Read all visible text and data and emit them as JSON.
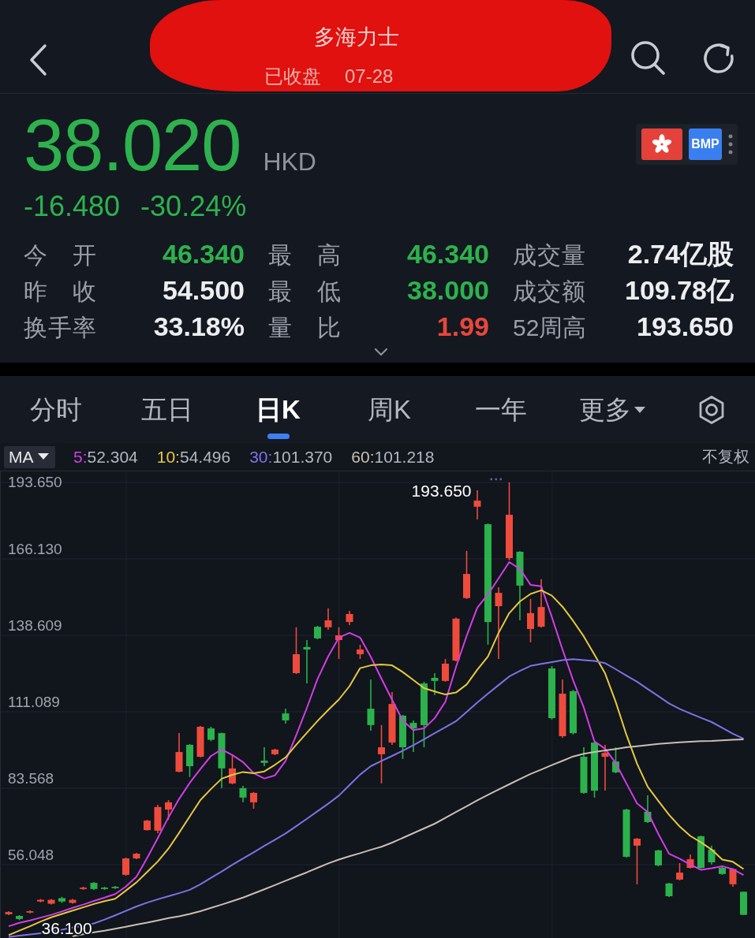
{
  "header": {
    "redacted": true,
    "title": "多海力士",
    "status": "已收盘",
    "date": "07-28"
  },
  "quote": {
    "price": "38.020",
    "currency": "HKD",
    "falling": true,
    "change": "-16.480",
    "change_percent": "-30.24%",
    "badge": "BMP"
  },
  "stats": [
    {
      "label": "今 开",
      "value": "46.340",
      "color": "#2db24e"
    },
    {
      "label": "最 高",
      "value": "46.340",
      "color": "#2db24e"
    },
    {
      "label": "成交量",
      "value": "2.74亿股",
      "color": "#eceef1"
    },
    {
      "label": "昨 收",
      "value": "54.500",
      "color": "#eceef1"
    },
    {
      "label": "最 低",
      "value": "38.000",
      "color": "#2db24e"
    },
    {
      "label": "成交额",
      "value": "109.78亿",
      "color": "#eceef1"
    },
    {
      "label": "换手率",
      "value": "33.18%",
      "color": "#eceef1"
    },
    {
      "label": "量 比",
      "value": "1.99",
      "color": "#e9463b"
    },
    {
      "label": "52周高",
      "value": "193.650",
      "color": "#eceef1"
    }
  ],
  "tabs": [
    {
      "label": "分时",
      "kind": "tab",
      "selected": false
    },
    {
      "label": "五日",
      "kind": "tab",
      "selected": false
    },
    {
      "label": "日K",
      "kind": "tab",
      "selected": true
    },
    {
      "label": "周K",
      "kind": "tab",
      "selected": false
    },
    {
      "label": "一年",
      "kind": "tab",
      "selected": false
    },
    {
      "label": "更多",
      "kind": "menu",
      "selected": false
    }
  ],
  "chart": {
    "indicator": "MA",
    "ma_legend": [
      {
        "label": "5:",
        "value": "52.304",
        "color": "#d23ee6"
      },
      {
        "label": "10:",
        "value": "54.496",
        "color": "#e6c940"
      },
      {
        "label": "30:",
        "value": "101.370",
        "color": "#7b74e6"
      },
      {
        "label": "60:",
        "value": "101.218",
        "color": "#c8c0b4"
      }
    ],
    "adjustment": "不复权",
    "chart_data": {
      "type": "candlestick",
      "grid": true,
      "ylim": [
        29.66,
        197.91
      ],
      "yticks": [
        {
          "value": 193.65,
          "label": "193.650"
        },
        {
          "value": 166.13,
          "label": "166.130"
        },
        {
          "value": 138.609,
          "label": "138.609"
        },
        {
          "value": 111.089,
          "label": "111.089"
        },
        {
          "value": 83.568,
          "label": "83.568"
        },
        {
          "value": 56.048,
          "label": "56.048"
        }
      ],
      "categories": [
        null,
        null,
        null,
        null,
        null,
        null,
        null,
        null,
        null,
        null,
        null,
        null,
        null,
        null,
        null,
        null,
        null,
        null,
        null,
        null,
        null,
        null,
        null,
        null,
        null,
        null,
        null,
        null,
        null,
        null,
        null,
        null,
        null,
        null,
        null,
        null,
        null,
        null,
        null,
        null,
        null,
        null,
        null,
        null,
        null,
        null,
        null,
        null,
        null,
        null,
        null,
        null,
        null,
        null,
        null,
        null,
        null,
        null,
        null,
        null,
        null,
        null,
        null,
        null,
        null,
        null,
        null,
        null,
        null,
        null
      ],
      "ohlc": [
        [
          38.2,
          39.3,
          37.9,
          39.0
        ],
        [
          37.6,
          37.9,
          36.1,
          36.5
        ],
        [
          38.8,
          39.6,
          38.5,
          39.3
        ],
        [
          42.8,
          43.7,
          42.5,
          43.4
        ],
        [
          42.0,
          43.7,
          41.7,
          43.4
        ],
        [
          44.0,
          44.5,
          42.3,
          42.8
        ],
        [
          42.3,
          43.7,
          42.0,
          43.4
        ],
        [
          47.3,
          48.1,
          47.0,
          47.8
        ],
        [
          49.5,
          49.8,
          47.0,
          47.3
        ],
        [
          47.8,
          48.1,
          47.0,
          47.3
        ],
        [
          48.1,
          48.4,
          47.3,
          47.6
        ],
        [
          52.4,
          58.6,
          52.1,
          58.3
        ],
        [
          58.3,
          60.3,
          58.0,
          60.0
        ],
        [
          68.5,
          72.2,
          68.3,
          71.9
        ],
        [
          68.3,
          77.6,
          67.4,
          76.8
        ],
        [
          75.9,
          79.3,
          72.2,
          78.5
        ],
        [
          89.5,
          103.4,
          89.3,
          96.6
        ],
        [
          99.2,
          99.5,
          87.6,
          91.5
        ],
        [
          94.9,
          106.0,
          94.6,
          105.7
        ],
        [
          105.1,
          105.7,
          100.5,
          101.0
        ],
        [
          103.4,
          103.6,
          83.6,
          90.7
        ],
        [
          85.3,
          95.8,
          85.0,
          90.7
        ],
        [
          83.6,
          84.4,
          78.5,
          80.2
        ],
        [
          78.5,
          82.2,
          76.2,
          81.9
        ],
        [
          93.5,
          98.3,
          91.5,
          92.7
        ],
        [
          95.8,
          97.8,
          95.5,
          97.5
        ],
        [
          110.5,
          112.2,
          106.8,
          108.0
        ],
        [
          125.0,
          141.5,
          124.7,
          131.8
        ],
        [
          134.4,
          136.9,
          121.3,
          133.5
        ],
        [
          141.7,
          142.0,
          137.2,
          137.5
        ],
        [
          141.5,
          148.3,
          140.6,
          144.0
        ],
        [
          136.9,
          141.5,
          130.1,
          138.6
        ],
        [
          143.4,
          147.4,
          142.3,
          146.3
        ],
        [
          131.8,
          135.2,
          130.1,
          133.5
        ],
        [
          112.2,
          122.7,
          104.3,
          106.3
        ],
        [
          95.8,
          106.3,
          85.3,
          98.3
        ],
        [
          100.0,
          118.2,
          99.2,
          113.9
        ],
        [
          109.7,
          109.9,
          94.1,
          98.3
        ],
        [
          107.1,
          108.0,
          96.6,
          105.1
        ],
        [
          121.3,
          121.9,
          98.3,
          106.3
        ],
        [
          123.3,
          125.0,
          117.1,
          122.2
        ],
        [
          122.2,
          130.1,
          121.9,
          128.4
        ],
        [
          129.5,
          145.0,
          129.2,
          144.6
        ],
        [
          152.0,
          169.0,
          151.7,
          160.7
        ],
        [
          184.9,
          190.8,
          180.3,
          187.1
        ],
        [
          178.6,
          178.9,
          135.2,
          143.4
        ],
        [
          149.1,
          155.9,
          130.1,
          153.9
        ],
        [
          166.4,
          193.65,
          165.6,
          182.0
        ],
        [
          168.7,
          168.9,
          144.0,
          156.5
        ],
        [
          140.9,
          151.7,
          136.1,
          146.6
        ],
        [
          141.7,
          158.8,
          141.4,
          148.8
        ],
        [
          126.7,
          127.5,
          108.3,
          108.8
        ],
        [
          102.3,
          122.7,
          101.7,
          117.6
        ],
        [
          118.5,
          119.0,
          102.9,
          103.4
        ],
        [
          94.9,
          98.3,
          81.6,
          81.9
        ],
        [
          100.0,
          100.3,
          80.2,
          82.7
        ],
        [
          94.9,
          99.2,
          82.7,
          96.3
        ],
        [
          93.2,
          98.3,
          89.0,
          89.3
        ],
        [
          75.9,
          76.2,
          58.6,
          58.9
        ],
        [
          62.9,
          65.7,
          49.0,
          65.4
        ],
        [
          75.1,
          81.0,
          71.1,
          71.4
        ],
        [
          61.2,
          61.4,
          55.5,
          55.8
        ],
        [
          49.3,
          49.5,
          44.4,
          44.7
        ],
        [
          50.7,
          56.6,
          50.4,
          53.2
        ],
        [
          54.9,
          59.7,
          54.7,
          58.0
        ],
        [
          66.3,
          66.5,
          54.7,
          54.9
        ],
        [
          61.5,
          62.9,
          56.1,
          56.9
        ],
        [
          54.9,
          55.2,
          52.4,
          52.7
        ],
        [
          49.0,
          54.8,
          48.1,
          54.5
        ],
        [
          46.3,
          46.3,
          38.0,
          38.0
        ]
      ],
      "series": [
        {
          "type": "line",
          "color": "#d23ee6",
          "values": [
            33.9,
            35.1,
            36.0,
            37.0,
            38.0,
            39.2,
            40.5,
            41.7,
            43.0,
            44.2,
            45.5,
            48.2,
            51.7,
            58.5,
            65.6,
            73.1,
            79.7,
            85.5,
            90.5,
            95.2,
            97.5,
            95.5,
            93.0,
            89.0,
            87.1,
            88.2,
            93.4,
            102.7,
            112.5,
            122.9,
            131.0,
            137.8,
            139.5,
            137.8,
            130.9,
            123.0,
            115.4,
            107.9,
            104.5,
            105.1,
            108.8,
            114.7,
            127.2,
            138.4,
            148.6,
            153.3,
            159.1,
            165.0,
            162.5,
            156.8,
            156.3,
            145.2,
            133.5,
            122.4,
            112.6,
            100.4,
            97.8,
            92.6,
            85.3,
            78.1,
            75.0,
            67.1,
            60.0,
            58.2,
            56.1,
            54.2,
            54.8,
            55.5,
            54.4,
            52.3
          ]
        },
        {
          "type": "line",
          "color": "#e6c940",
          "values": [
            30.7,
            32.3,
            33.9,
            35.6,
            37.1,
            38.3,
            39.5,
            40.7,
            41.9,
            42.9,
            43.8,
            46.7,
            49.7,
            53.4,
            57.2,
            61.8,
            67.5,
            73.4,
            79.3,
            83.3,
            87.0,
            88.4,
            89.4,
            89.0,
            89.6,
            92.0,
            94.7,
            99.2,
            103.5,
            107.8,
            111.7,
            115.5,
            120.3,
            126.8,
            127.8,
            128.1,
            127.8,
            125.4,
            122.5,
            119.6,
            118.4,
            117.3,
            118.0,
            120.9,
            126.2,
            131.0,
            139.5,
            146.6,
            150.8,
            153.5,
            154.8,
            152.9,
            148.9,
            143.8,
            138.2,
            131.7,
            124.9,
            114.6,
            102.8,
            92.4,
            84.1,
            79.0,
            74.0,
            69.8,
            66.4,
            64.1,
            61.5,
            57.9,
            57.1,
            54.5
          ]
        },
        {
          "type": "line",
          "color": "#7b74e6",
          "values": [
            30.0,
            30.5,
            30.9,
            31.4,
            31.9,
            32.6,
            33.4,
            34.1,
            34.9,
            36.3,
            37.8,
            39.4,
            41.0,
            42.4,
            43.6,
            44.7,
            45.8,
            47.0,
            49.0,
            51.3,
            53.6,
            56.0,
            58.3,
            60.5,
            62.8,
            65.0,
            67.3,
            69.9,
            72.6,
            75.3,
            78.0,
            80.9,
            84.7,
            88.5,
            91.5,
            93.4,
            95.2,
            97.1,
            99.1,
            101.2,
            103.4,
            105.5,
            107.7,
            111.0,
            114.4,
            117.6,
            120.7,
            123.8,
            125.8,
            127.6,
            128.3,
            129.0,
            129.7,
            130.0,
            129.7,
            129.4,
            128.6,
            126.4,
            124.1,
            121.9,
            119.3,
            116.7,
            114.1,
            112.1,
            110.5,
            108.9,
            107.4,
            105.3,
            103.2,
            101.4
          ]
        },
        {
          "type": "line",
          "color": "#c8c0b4",
          "values": [
            null,
            null,
            null,
            null,
            null,
            null,
            30.3,
            31.0,
            31.7,
            32.3,
            33.0,
            33.7,
            34.5,
            35.2,
            36.0,
            36.8,
            37.5,
            38.3,
            39.3,
            40.5,
            41.7,
            42.9,
            44.2,
            45.7,
            47.2,
            48.7,
            50.3,
            51.8,
            53.3,
            54.9,
            56.5,
            57.9,
            59.1,
            60.2,
            61.4,
            62.5,
            64.0,
            65.7,
            67.4,
            69.1,
            70.8,
            72.9,
            75.0,
            77.1,
            79.2,
            81.2,
            83.1,
            85.0,
            86.9,
            88.7,
            90.3,
            91.9,
            93.4,
            95.0,
            96.0,
            96.6,
            97.2,
            97.7,
            98.3,
            98.7,
            99.1,
            99.5,
            99.8,
            100.1,
            100.3,
            100.5,
            100.6,
            100.8,
            101.0,
            101.2
          ]
        }
      ],
      "annotations": [
        "193.650",
        "36.100"
      ]
    }
  }
}
